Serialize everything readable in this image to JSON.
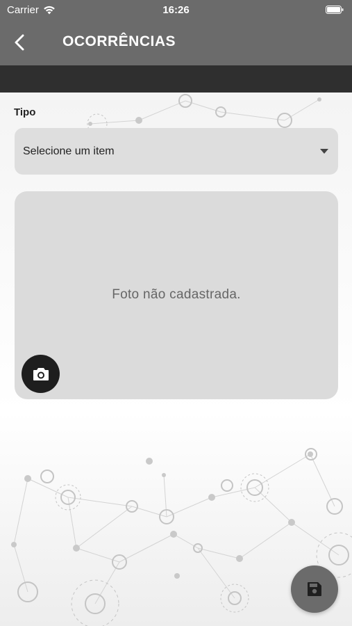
{
  "status_bar": {
    "carrier": "Carrier",
    "time": "16:26"
  },
  "header": {
    "title": "OCORRÊNCIAS"
  },
  "form": {
    "tipo_label": "Tipo",
    "tipo_value": "Selecione um item"
  },
  "photo": {
    "empty_text": "Foto não cadastrada."
  },
  "icons": {
    "back": "chevron-left-icon",
    "camera": "camera-icon",
    "save": "floppy-disk-icon",
    "dropdown": "caret-down-icon"
  },
  "colors": {
    "header_bg": "#6b6b6b",
    "subbar_bg": "#2f2f2f",
    "field_bg": "#dedede",
    "camera_button": "#1e1e1e",
    "fab": "#6b6b6b"
  }
}
